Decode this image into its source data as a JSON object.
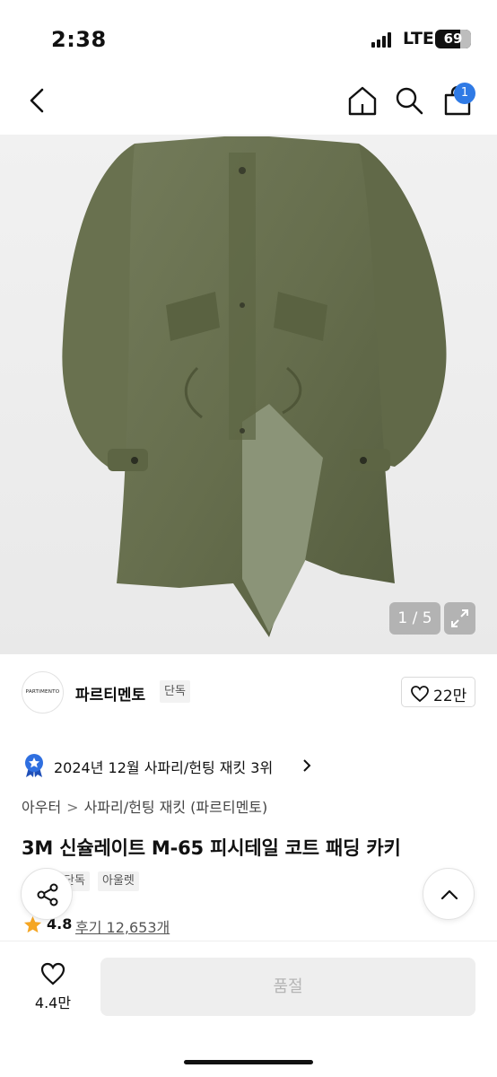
{
  "status_bar": {
    "time": "2:38",
    "network": "LTE",
    "battery": "69"
  },
  "header": {
    "cart_badge": "1"
  },
  "gallery": {
    "counter": "1 / 5"
  },
  "brand": {
    "logo_text": "PARTIMENTO",
    "name": "파르티멘토",
    "tag": "단독",
    "like_count": "22만"
  },
  "ranking": {
    "text": "2024년 12월 사파리/헌팅 재킷 3위"
  },
  "breadcrumb": {
    "items": [
      "아우터",
      "사파리/헌팅 재킷 (파르티멘토)"
    ]
  },
  "product": {
    "title": "3M 신슐레이트 M-65 피시테일 코트 패딩 카키",
    "tags": [
      "단독",
      "아울렛"
    ],
    "rating": "4.8",
    "reviews": "후기 12,653개"
  },
  "bottom_bar": {
    "like_count": "4.4만",
    "buy_label": "품절"
  },
  "colors": {
    "accent": "#2f7ae5",
    "star": "#f5a623",
    "soldout_bg": "#eeeeee"
  }
}
